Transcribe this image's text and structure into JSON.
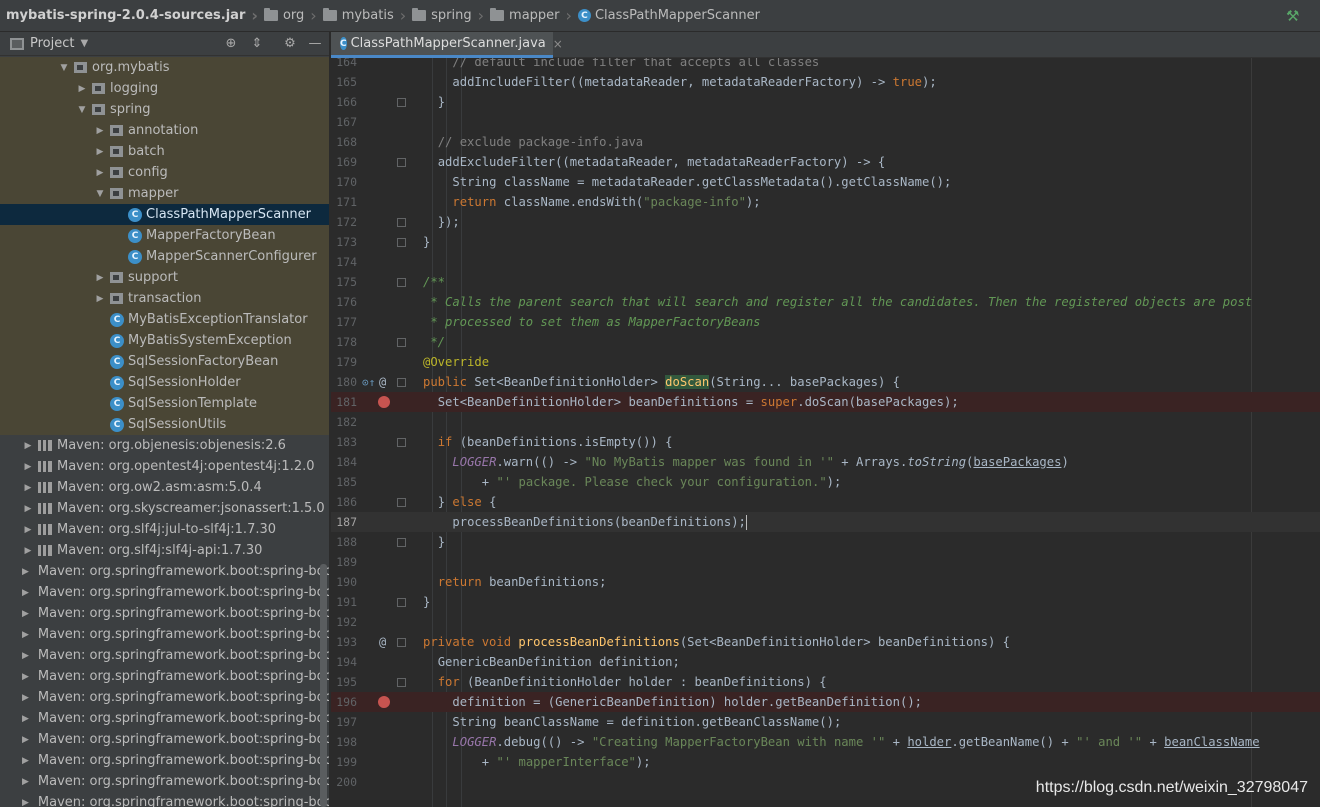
{
  "breadcrumb": [
    {
      "label": "mybatis-spring-2.0.4-sources.jar",
      "kind": "jar"
    },
    {
      "label": "org",
      "kind": "folder"
    },
    {
      "label": "mybatis",
      "kind": "folder"
    },
    {
      "label": "spring",
      "kind": "folder"
    },
    {
      "label": "mapper",
      "kind": "folder"
    },
    {
      "label": "ClassPathMapperScanner",
      "kind": "class"
    }
  ],
  "project": {
    "title": "Project",
    "tree": [
      {
        "label": "org.mybatis",
        "depth": 3,
        "arrow": "down",
        "icon": "pkg",
        "tint": true
      },
      {
        "label": "logging",
        "depth": 4,
        "arrow": "right",
        "icon": "pkg",
        "tint": true
      },
      {
        "label": "spring",
        "depth": 4,
        "arrow": "down",
        "icon": "pkg",
        "tint": true
      },
      {
        "label": "annotation",
        "depth": 5,
        "arrow": "right",
        "icon": "pkg",
        "tint": true
      },
      {
        "label": "batch",
        "depth": 5,
        "arrow": "right",
        "icon": "pkg",
        "tint": true
      },
      {
        "label": "config",
        "depth": 5,
        "arrow": "right",
        "icon": "pkg",
        "tint": true
      },
      {
        "label": "mapper",
        "depth": 5,
        "arrow": "down",
        "icon": "pkg",
        "tint": true
      },
      {
        "label": "ClassPathMapperScanner",
        "depth": 6,
        "arrow": "none",
        "icon": "class",
        "selected": true
      },
      {
        "label": "MapperFactoryBean",
        "depth": 6,
        "arrow": "none",
        "icon": "class",
        "tint": true
      },
      {
        "label": "MapperScannerConfigurer",
        "depth": 6,
        "arrow": "none",
        "icon": "class",
        "tint": true
      },
      {
        "label": "support",
        "depth": 5,
        "arrow": "right",
        "icon": "pkg",
        "tint": true
      },
      {
        "label": "transaction",
        "depth": 5,
        "arrow": "right",
        "icon": "pkg",
        "tint": true
      },
      {
        "label": "MyBatisExceptionTranslator",
        "depth": 5,
        "arrow": "none",
        "icon": "class",
        "tint": true
      },
      {
        "label": "MyBatisSystemException",
        "depth": 5,
        "arrow": "none",
        "icon": "class",
        "tint": true
      },
      {
        "label": "SqlSessionFactoryBean",
        "depth": 5,
        "arrow": "none",
        "icon": "class",
        "tint": true
      },
      {
        "label": "SqlSessionHolder",
        "depth": 5,
        "arrow": "none",
        "icon": "class",
        "tint": true
      },
      {
        "label": "SqlSessionTemplate",
        "depth": 5,
        "arrow": "none",
        "icon": "class",
        "tint": true
      },
      {
        "label": "SqlSessionUtils",
        "depth": 5,
        "arrow": "none",
        "icon": "class",
        "tint": true
      },
      {
        "label": "Maven: org.objenesis:objenesis:2.6",
        "depth": 1,
        "arrow": "right",
        "icon": "lib"
      },
      {
        "label": "Maven: org.opentest4j:opentest4j:1.2.0",
        "depth": 1,
        "arrow": "right",
        "icon": "lib"
      },
      {
        "label": "Maven: org.ow2.asm:asm:5.0.4",
        "depth": 1,
        "arrow": "right",
        "icon": "lib"
      },
      {
        "label": "Maven: org.skyscreamer:jsonassert:1.5.0",
        "depth": 1,
        "arrow": "right",
        "icon": "lib"
      },
      {
        "label": "Maven: org.slf4j:jul-to-slf4j:1.7.30",
        "depth": 1,
        "arrow": "right",
        "icon": "lib"
      },
      {
        "label": "Maven: org.slf4j:slf4j-api:1.7.30",
        "depth": 1,
        "arrow": "right",
        "icon": "lib"
      },
      {
        "label": "Maven: org.springframework.boot:spring-boo",
        "depth": 1,
        "arrow": "right",
        "icon": "lib"
      },
      {
        "label": "Maven: org.springframework.boot:spring-boo",
        "depth": 1,
        "arrow": "right",
        "icon": "lib"
      },
      {
        "label": "Maven: org.springframework.boot:spring-boo",
        "depth": 1,
        "arrow": "right",
        "icon": "lib"
      },
      {
        "label": "Maven: org.springframework.boot:spring-boo",
        "depth": 1,
        "arrow": "right",
        "icon": "lib"
      },
      {
        "label": "Maven: org.springframework.boot:spring-boo",
        "depth": 1,
        "arrow": "right",
        "icon": "lib"
      },
      {
        "label": "Maven: org.springframework.boot:spring-boo",
        "depth": 1,
        "arrow": "right",
        "icon": "lib"
      },
      {
        "label": "Maven: org.springframework.boot:spring-boo",
        "depth": 1,
        "arrow": "right",
        "icon": "lib"
      },
      {
        "label": "Maven: org.springframework.boot:spring-boo",
        "depth": 1,
        "arrow": "right",
        "icon": "lib"
      },
      {
        "label": "Maven: org.springframework.boot:spring-boo",
        "depth": 1,
        "arrow": "right",
        "icon": "lib"
      },
      {
        "label": "Maven: org.springframework.boot:spring-boo",
        "depth": 1,
        "arrow": "right",
        "icon": "lib"
      },
      {
        "label": "Maven: org.springframework.boot:spring-boo",
        "depth": 1,
        "arrow": "right",
        "icon": "lib"
      },
      {
        "label": "Maven: org.springframework.boot:spring-boo",
        "depth": 1,
        "arrow": "right",
        "icon": "lib"
      },
      {
        "label": "Maven: org.springframework.boot:spring-boo",
        "depth": 1,
        "arrow": "right",
        "icon": "lib"
      }
    ]
  },
  "editor": {
    "tab_label": "ClassPathMapperScanner.java",
    "tab_close": "×",
    "lines": [
      {
        "n": "164",
        "indent": 4,
        "parts": [
          [
            "c",
            "// default include filter that accepts all classes"
          ]
        ]
      },
      {
        "n": "165",
        "indent": 4,
        "parts": [
          [
            "",
            "addIncludeFilter((metadataReader, metadataReaderFactory) -> "
          ],
          [
            "k",
            "true"
          ],
          [
            "",
            ");"
          ]
        ]
      },
      {
        "n": "166",
        "indent": 3,
        "fold": true,
        "parts": [
          [
            "",
            "}"
          ]
        ]
      },
      {
        "n": "167",
        "indent": 0,
        "parts": []
      },
      {
        "n": "168",
        "indent": 3,
        "parts": [
          [
            "c",
            "// exclude package-info.java"
          ]
        ]
      },
      {
        "n": "169",
        "indent": 3,
        "fold": true,
        "parts": [
          [
            "",
            "addExcludeFilter((metadataReader, metadataReaderFactory) -> {"
          ]
        ]
      },
      {
        "n": "170",
        "indent": 4,
        "parts": [
          [
            "",
            "String className = metadataReader.getClassMetadata().getClassName();"
          ]
        ]
      },
      {
        "n": "171",
        "indent": 4,
        "parts": [
          [
            "k",
            "return "
          ],
          [
            "",
            "className.endsWith("
          ],
          [
            "s",
            "\"package-info\""
          ],
          [
            "",
            ");"
          ]
        ]
      },
      {
        "n": "172",
        "indent": 3,
        "fold": true,
        "parts": [
          [
            "",
            "});"
          ]
        ]
      },
      {
        "n": "173",
        "indent": 2,
        "fold": true,
        "parts": [
          [
            "",
            "}"
          ]
        ]
      },
      {
        "n": "174",
        "indent": 0,
        "parts": []
      },
      {
        "n": "175",
        "indent": 2,
        "fold": true,
        "parts": [
          [
            "d",
            "/**"
          ]
        ]
      },
      {
        "n": "176",
        "indent": 2,
        "parts": [
          [
            "d",
            " * Calls the parent search that will search and register all the candidates. Then the registered objects are post"
          ]
        ]
      },
      {
        "n": "177",
        "indent": 2,
        "parts": [
          [
            "d",
            " * processed to set them as MapperFactoryBeans"
          ]
        ]
      },
      {
        "n": "178",
        "indent": 2,
        "fold": true,
        "parts": [
          [
            "d",
            " */"
          ]
        ]
      },
      {
        "n": "179",
        "indent": 2,
        "parts": [
          [
            "a",
            "@Override"
          ]
        ]
      },
      {
        "n": "180",
        "indent": 2,
        "fold": true,
        "override": true,
        "parts": [
          [
            "k",
            "public "
          ],
          [
            "",
            "Set<BeanDefinitionHolder> "
          ],
          [
            "hl",
            "doScan"
          ],
          [
            "",
            "(String... basePackages) {"
          ]
        ]
      },
      {
        "n": "181",
        "indent": 3,
        "breakpoint": true,
        "parts": [
          [
            "",
            "Set<BeanDefinitionHolder> beanDefinitions = "
          ],
          [
            "k",
            "super"
          ],
          [
            "",
            ".doScan(basePackages);"
          ]
        ]
      },
      {
        "n": "182",
        "indent": 0,
        "parts": []
      },
      {
        "n": "183",
        "indent": 3,
        "fold": true,
        "parts": [
          [
            "k",
            "if "
          ],
          [
            "",
            "(beanDefinitions.isEmpty()) {"
          ]
        ]
      },
      {
        "n": "184",
        "indent": 4,
        "parts": [
          [
            "st",
            "LOGGER"
          ],
          [
            "",
            ".warn(() -> "
          ],
          [
            "s",
            "\"No MyBatis mapper was found in '\""
          ],
          [
            "",
            " + Arrays."
          ],
          [
            "it",
            "toString"
          ],
          [
            "",
            "("
          ],
          [
            "u",
            "basePackages"
          ],
          [
            "",
            ")"
          ]
        ]
      },
      {
        "n": "185",
        "indent": 6,
        "parts": [
          [
            "",
            "+ "
          ],
          [
            "s",
            "\"' package. Please check your configuration.\""
          ],
          [
            "",
            ");"
          ]
        ]
      },
      {
        "n": "186",
        "indent": 3,
        "fold": true,
        "parts": [
          [
            "",
            "} "
          ],
          [
            "k",
            "else "
          ],
          [
            "",
            "{"
          ]
        ]
      },
      {
        "n": "187",
        "indent": 4,
        "current": true,
        "parts": [
          [
            "",
            "processBeanDefinitions(beanDefinitions);"
          ],
          [
            "caret",
            ""
          ]
        ]
      },
      {
        "n": "188",
        "indent": 3,
        "fold": true,
        "parts": [
          [
            "",
            "}"
          ]
        ]
      },
      {
        "n": "189",
        "indent": 0,
        "parts": []
      },
      {
        "n": "190",
        "indent": 3,
        "parts": [
          [
            "k",
            "return "
          ],
          [
            "",
            "beanDefinitions;"
          ]
        ]
      },
      {
        "n": "191",
        "indent": 2,
        "fold": true,
        "parts": [
          [
            "",
            "}"
          ]
        ]
      },
      {
        "n": "192",
        "indent": 0,
        "parts": []
      },
      {
        "n": "193",
        "indent": 2,
        "fold": true,
        "at": true,
        "parts": [
          [
            "k",
            "private void "
          ],
          [
            "f",
            "processBeanDefinitions"
          ],
          [
            "",
            "(Set<BeanDefinitionHolder> beanDefinitions) {"
          ]
        ]
      },
      {
        "n": "194",
        "indent": 3,
        "parts": [
          [
            "",
            "GenericBeanDefinition definition;"
          ]
        ]
      },
      {
        "n": "195",
        "indent": 3,
        "fold": true,
        "parts": [
          [
            "k",
            "for "
          ],
          [
            "",
            "(BeanDefinitionHolder holder : beanDefinitions) {"
          ]
        ]
      },
      {
        "n": "196",
        "indent": 4,
        "breakpoint": true,
        "parts": [
          [
            "",
            "definition = (GenericBeanDefinition) holder.getBeanDefinition();"
          ]
        ]
      },
      {
        "n": "197",
        "indent": 4,
        "parts": [
          [
            "",
            "String beanClassName = definition.getBeanClassName();"
          ]
        ]
      },
      {
        "n": "198",
        "indent": 4,
        "parts": [
          [
            "st",
            "LOGGER"
          ],
          [
            "",
            ".debug(() -> "
          ],
          [
            "s",
            "\"Creating MapperFactoryBean with name '\""
          ],
          [
            "",
            " + "
          ],
          [
            "u",
            "holder"
          ],
          [
            "",
            ".getBeanName() + "
          ],
          [
            "s",
            "\"' and '\""
          ],
          [
            "",
            " + "
          ],
          [
            "u",
            "beanClassName"
          ]
        ]
      },
      {
        "n": "199",
        "indent": 6,
        "parts": [
          [
            "",
            "+ "
          ],
          [
            "s",
            "\"' mapperInterface\""
          ],
          [
            "",
            ");"
          ]
        ]
      },
      {
        "n": "200",
        "indent": 0,
        "parts": []
      }
    ]
  },
  "watermark": "https://blog.csdn.net/weixin_32798047",
  "colors": {
    "accent": "#4a88c7",
    "breakpoint": "#c75450",
    "selection": "#0d293e",
    "keyword": "#cc7832",
    "string": "#6a8759"
  }
}
